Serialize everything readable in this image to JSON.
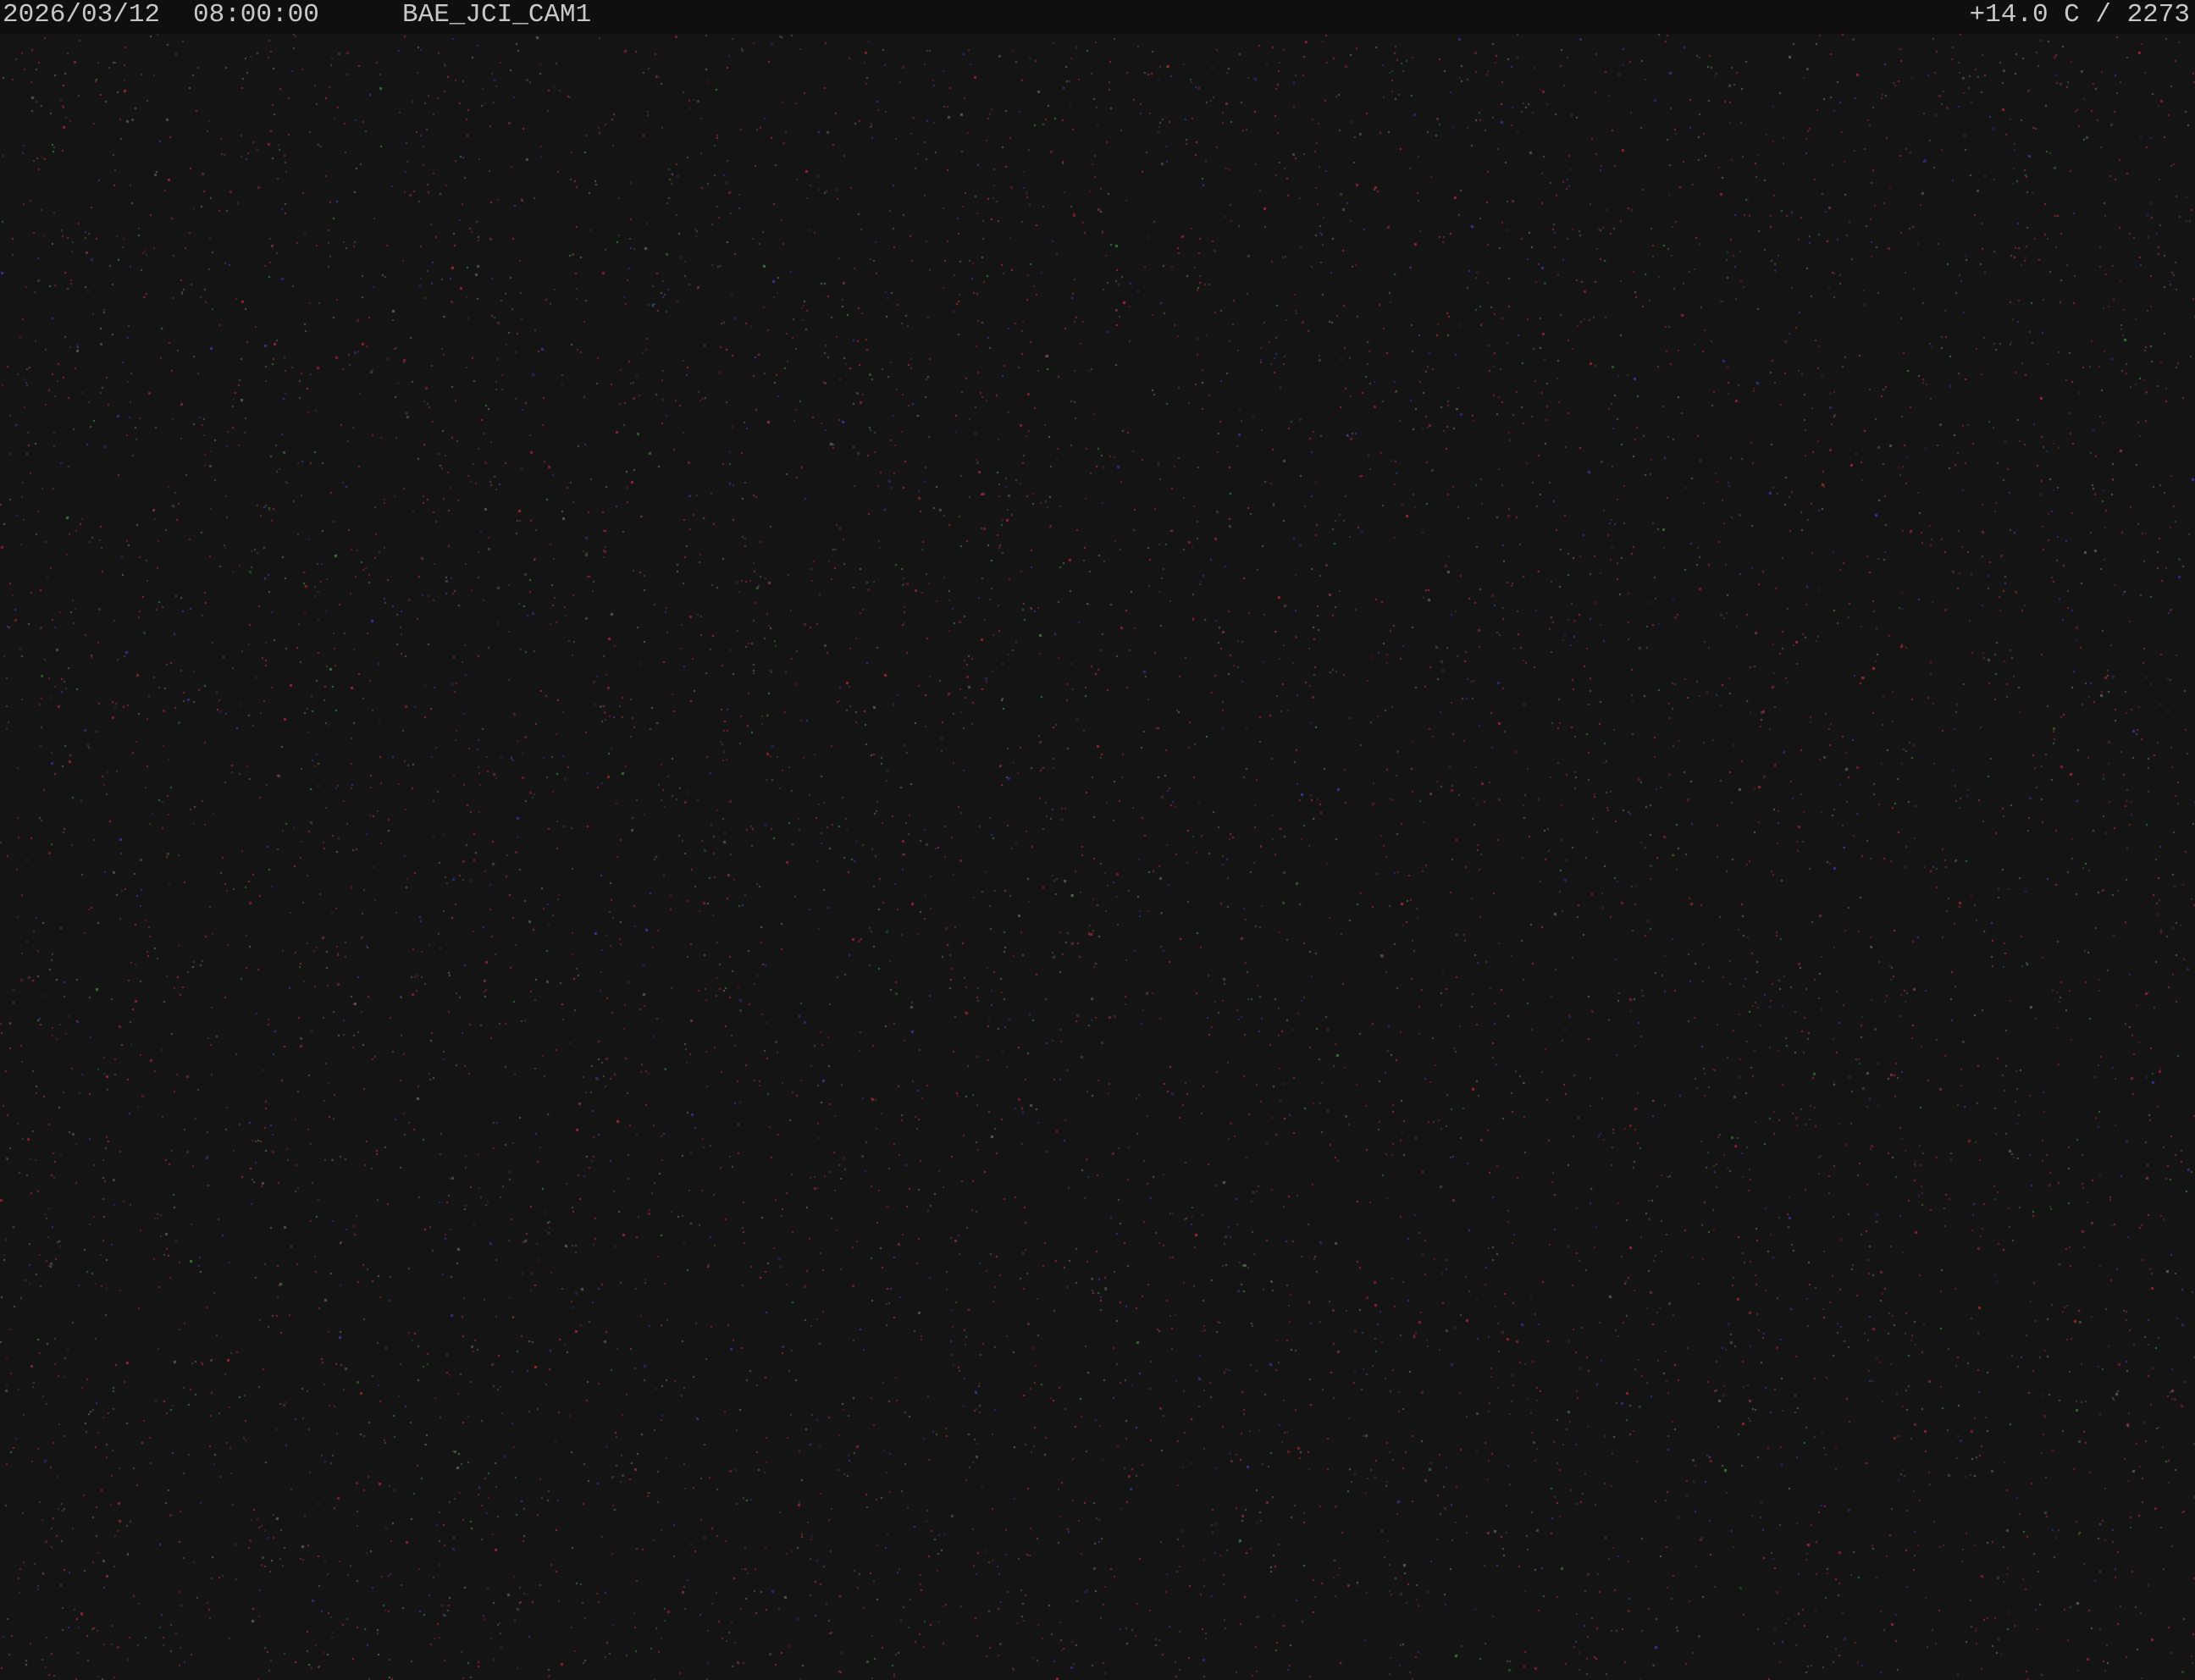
{
  "overlay": {
    "date": "2026/03/12",
    "time": "08:00:00",
    "camera_id": "BAE_JCI_CAM1",
    "temperature_reading": "+14.0 C / 2273"
  },
  "scene": {
    "background_color": "#141414",
    "noise_colors": [
      "#b8283c",
      "#3c3cb8",
      "#3c8c3c",
      "#6a6a6a",
      "#8a3a4a"
    ]
  }
}
